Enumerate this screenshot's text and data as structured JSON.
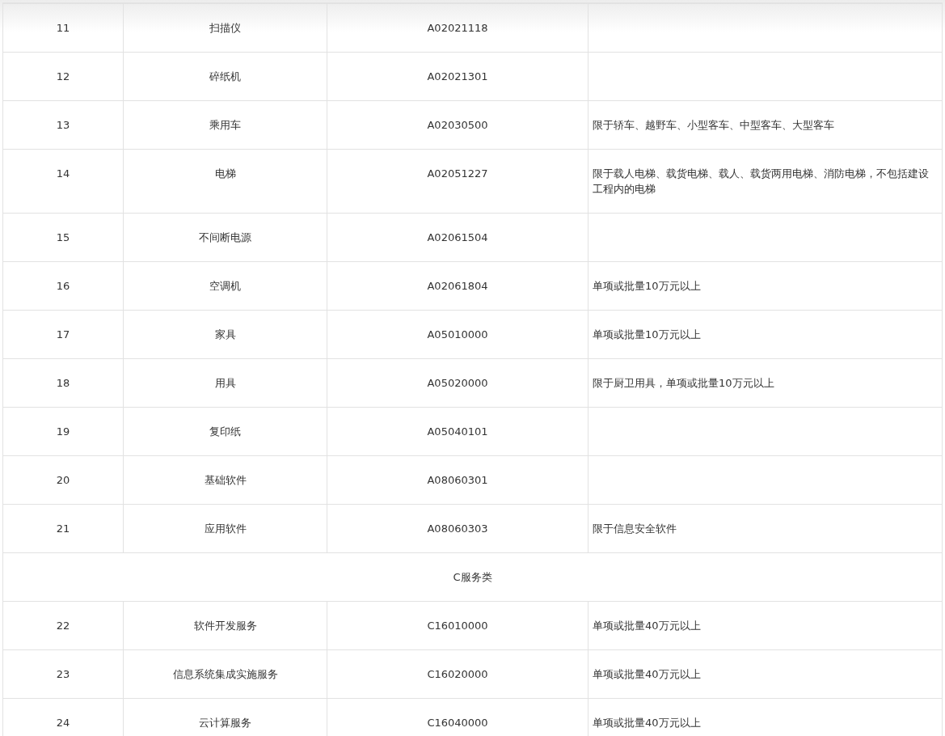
{
  "table": {
    "rows": [
      {
        "kind": "item",
        "number": "11",
        "name": "扫描仪",
        "code": "A02021118"
      },
      {
        "kind": "item",
        "number": "12",
        "name": "碎纸机",
        "code": "A02021301"
      },
      {
        "kind": "item",
        "number": "13",
        "name": "乘用车",
        "code": "A02030500",
        "note": "限于轿车、越野车、小型客车、中型客车、大型客车"
      },
      {
        "kind": "item",
        "number": "14",
        "name": "电梯",
        "code": "A02051227",
        "note": "限于载人电梯、载货电梯、载人、载货两用电梯、消防电梯，不包括建设工程内的电梯"
      },
      {
        "kind": "item",
        "number": "15",
        "name": "不间断电源",
        "code": "A02061504"
      },
      {
        "kind": "item",
        "number": "16",
        "name": "空调机",
        "code": "A02061804",
        "note": "单项或批量10万元以上"
      },
      {
        "kind": "item",
        "number": "17",
        "name": "家具",
        "code": "A05010000",
        "note": "单项或批量10万元以上"
      },
      {
        "kind": "item",
        "number": "18",
        "name": "用具",
        "code": "A05020000",
        "note": "限于厨卫用具，单项或批量10万元以上"
      },
      {
        "kind": "item",
        "number": "19",
        "name": "复印纸",
        "code": "A05040101"
      },
      {
        "kind": "item",
        "number": "20",
        "name": "基础软件",
        "code": "A08060301"
      },
      {
        "kind": "item",
        "number": "21",
        "name": "应用软件",
        "code": "A08060303",
        "note": "限于信息安全软件"
      },
      {
        "kind": "category",
        "title": "C服务类"
      },
      {
        "kind": "item",
        "number": "22",
        "name": "软件开发服务",
        "code": "C16010000",
        "note": "单项或批量40万元以上"
      },
      {
        "kind": "item",
        "number": "23",
        "name": "信息系统集成实施服务",
        "code": "C16020000",
        "note": "单项或批量40万元以上"
      },
      {
        "kind": "item",
        "number": "24",
        "name": "云计算服务",
        "code": "C16040000",
        "note": "单项或批量40万元以上"
      }
    ]
  }
}
